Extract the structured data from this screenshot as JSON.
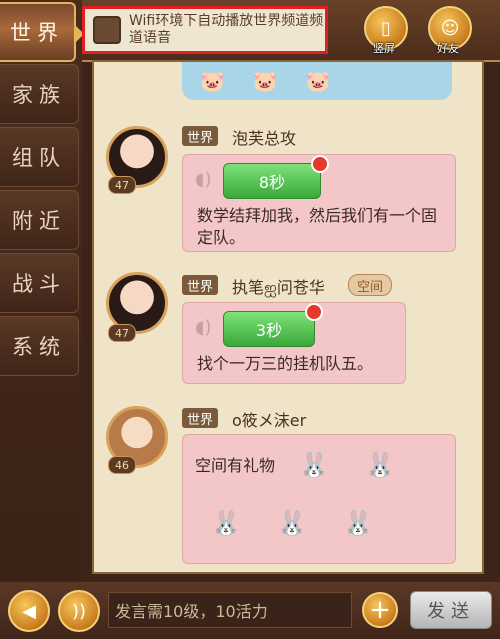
{
  "sidebar": {
    "tabs": [
      {
        "label": "世界",
        "active": true
      },
      {
        "label": "家族"
      },
      {
        "label": "组队"
      },
      {
        "label": "附近"
      },
      {
        "label": "战斗"
      },
      {
        "label": "系统"
      }
    ]
  },
  "topbar": {
    "wifi_setting": "Wifi环境下自动播放世界频道频道语音",
    "buttons": [
      {
        "label": "竖屏",
        "icon": "phone-portrait-icon"
      },
      {
        "label": "好友",
        "icon": "friends-icon"
      }
    ]
  },
  "messages": [
    {
      "channel": "世界",
      "user": "泡芙总攻",
      "level": "47",
      "voice": "8秒",
      "text": "数学结拜加我，然后我们有一个固定队。"
    },
    {
      "channel": "世界",
      "user": "执笔ஐ问苍华",
      "badge": "空间",
      "level": "47",
      "voice": "3秒",
      "text": "找个一万三的挂机队五。"
    },
    {
      "channel": "世界",
      "user": "o筱メ沫er",
      "level": "46",
      "text": "空间有礼物"
    }
  ],
  "input": {
    "placeholder": "发言需10级，10活力"
  },
  "send_label": "发送"
}
